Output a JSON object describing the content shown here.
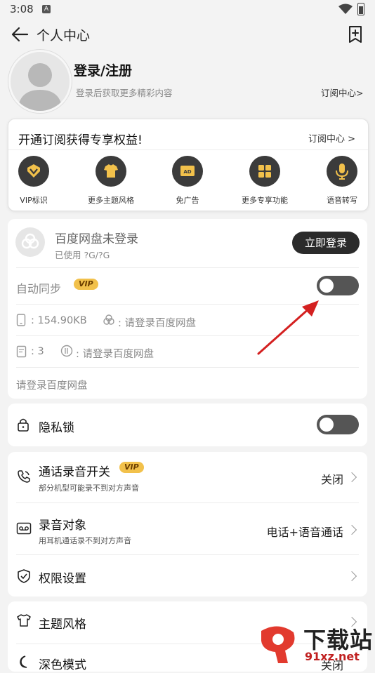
{
  "status": {
    "time": "3:08",
    "notif": "A"
  },
  "header": {
    "title": "个人中心"
  },
  "profile": {
    "login_title": "登录/注册",
    "login_sub": "登录后获取更多精彩内容",
    "sub_center_link": "订阅中心>"
  },
  "subscription": {
    "title": "开通订阅获得专享权益!",
    "link": "订阅中心 >",
    "features": [
      {
        "label": "VIP标识",
        "icon": "vip-diamond-icon"
      },
      {
        "label": "更多主题风格",
        "icon": "shirt-icon"
      },
      {
        "label": "免广告",
        "icon": "ad-icon"
      },
      {
        "label": "更多专享功能",
        "icon": "grid-icon"
      },
      {
        "label": "语音转写",
        "icon": "microphone-icon"
      }
    ]
  },
  "sync": {
    "baidu_title": "百度网盘未登录",
    "used": "已使用 ?G/?G",
    "login_button": "立即登录",
    "auto_sync": "自动同步",
    "vip": "VIP",
    "local_size": ": 154.90KB",
    "cloud_size": ": 请登录百度网盘",
    "local_count": ": 3",
    "cloud_count": ": 请登录百度网盘",
    "hint": "请登录百度网盘",
    "auto_sync_on": false
  },
  "privacy": {
    "label": "隐私锁",
    "on": false
  },
  "recording": {
    "call_record_title": "通话录音开关",
    "vip": "VIP",
    "call_record_sub": "部分机型可能录不到对方声音",
    "call_record_value": "关闭",
    "target_title": "录音对象",
    "target_sub": "用耳机通话录不到对方声音",
    "target_value": "电话+语音通话",
    "permission_title": "权限设置"
  },
  "theme": {
    "theme_title": "主题风格",
    "dark_title": "深色模式",
    "dark_value": "关闭"
  },
  "watermark": {
    "brand": "下载站",
    "site": "91xz.net"
  },
  "colors": {
    "accent_dark": "#2b2b2b",
    "vip_gold": "#f2c14b",
    "arrow_red": "#d42020"
  }
}
